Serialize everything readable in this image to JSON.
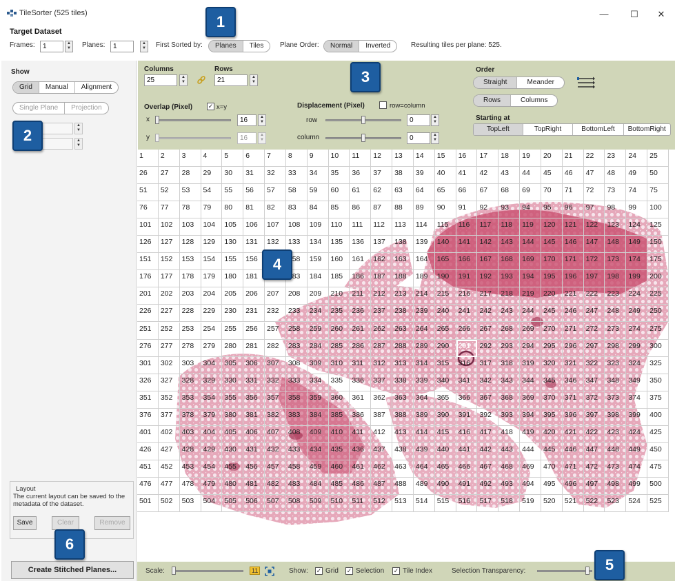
{
  "window": {
    "title": "TileSorter (525 tiles)",
    "minimize": "—",
    "maximize": "☐",
    "close": "✕",
    "icon": "tilesorter-app-icon"
  },
  "target": {
    "heading": "Target Dataset",
    "frames_label": "Frames:",
    "frames_value": "1",
    "planes_label": "Planes:",
    "planes_value": "1",
    "sorted_label": "First Sorted by:",
    "sorted_options": [
      "Planes",
      "Tiles"
    ],
    "sorted_selected": "Planes",
    "order_label": "Plane Order:",
    "order_options": [
      "Normal",
      "Inverted"
    ],
    "order_selected": "Normal",
    "result_text": "Resulting tiles per plane: 525."
  },
  "show": {
    "heading": "Show",
    "modes": [
      "Grid",
      "Manual",
      "Alignment"
    ],
    "mode_selected": "Grid",
    "plane_modes": [
      "Single Plane",
      "Projection"
    ]
  },
  "layout_box": {
    "title": "Layout",
    "description": "The current layout can be saved to the metadata of the dataset.",
    "save": "Save",
    "clear": "Clear",
    "remove": "Remove"
  },
  "create_button": "Create Stitched Planes...",
  "grid_settings": {
    "columns_label": "Columns",
    "columns_value": "25",
    "rows_label": "Rows",
    "rows_value": "21",
    "overlap_label": "Overlap (Pixel)",
    "overlap_xy_label": "x=y",
    "overlap_xy_checked": true,
    "x_label": "x",
    "x_value": "16",
    "x_fraction": 0.0,
    "y_label": "y",
    "y_value": "16",
    "y_fraction": 0.0,
    "displacement_label": "Displacement (Pixel)",
    "rowcol_label": "row=column",
    "rowcol_checked": false,
    "row_label": "row",
    "row_value": "0",
    "row_fraction": 0.5,
    "column_label": "column",
    "column_value": "0",
    "column_fraction": 0.5
  },
  "order": {
    "heading": "Order",
    "modes": [
      "Straight",
      "Meander"
    ],
    "mode_selected": "Straight",
    "dirs": [
      "Rows",
      "Columns"
    ],
    "dir_selected": "Rows",
    "starting_label": "Starting at",
    "starts": [
      "TopLeft",
      "TopRight",
      "BottomLeft",
      "BottomRight"
    ],
    "start_selected": "TopLeft",
    "preview_icon": "order-preview-icon"
  },
  "tiles": {
    "count": 525,
    "columns": 25,
    "selected": 291,
    "visible_rows": 22
  },
  "bottom": {
    "scale_label": "Scale:",
    "scale_fraction": 0.0,
    "scale_value": "11",
    "fit_icon": "fit-to-window-icon",
    "show_label": "Show:",
    "grid_label": "Grid",
    "selection_label": "Selection",
    "tile_index_label": "Tile Index",
    "transparency_label": "Selection Transparency:",
    "transparency_fraction": 0.95
  },
  "badges": [
    "1",
    "2",
    "3",
    "4",
    "5",
    "6"
  ],
  "colors": {
    "panel_green": "#d0d6b8",
    "badge_blue": "#1e5ea1",
    "tissue_pink": "#c94f6f",
    "tissue_light": "#e6a3b5"
  }
}
